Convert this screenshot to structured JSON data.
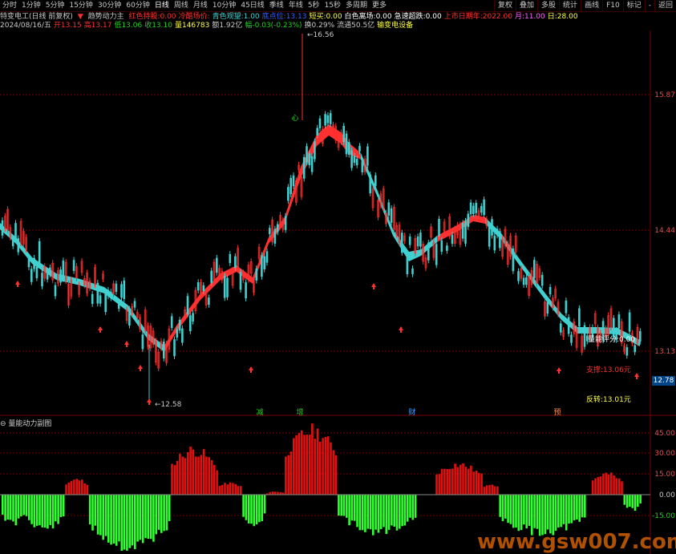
{
  "toolbar": {
    "periods": [
      "分时",
      "1分钟",
      "5分钟",
      "15分钟",
      "30分钟",
      "60分钟",
      "日线",
      "周线",
      "月线",
      "10分钟",
      "45日线",
      "季线",
      "年线",
      "5秒",
      "15秒",
      "多周期",
      "更多"
    ],
    "active_index": 6,
    "right_items": [
      "复权",
      "叠加",
      "多股",
      "统计",
      "画线",
      "F10",
      "标记",
      "-",
      "返回"
    ]
  },
  "legend_line1": {
    "stock": "特变电工(日线 前复权)",
    "indicator": "趋势动力主",
    "items": [
      {
        "label": "红色持股:",
        "value": "0.00",
        "color": "#ff3030"
      },
      {
        "label": "冷酷场价:",
        "value": "",
        "color": "#ff3030"
      },
      {
        "label": "青色观望:",
        "value": "1.00",
        "color": "#40d0d0"
      },
      {
        "label": "底点位:",
        "value": "13.13",
        "color": "#3060ff"
      },
      {
        "label": "短买:",
        "value": "0.00",
        "color": "#ffff40"
      },
      {
        "label": "白色离场:",
        "value": "0.00",
        "color": "#ffffff"
      },
      {
        "label": "急速超跌:",
        "value": "0.00",
        "color": "#ffffff"
      },
      {
        "label": "上市日期年:",
        "value": "2022.00",
        "color": "#ff3030"
      },
      {
        "label": "月:",
        "value": "11.00",
        "color": "#ff60ff"
      },
      {
        "label": "日:",
        "value": "28.00",
        "color": "#ffff40"
      }
    ]
  },
  "legend_line2": [
    {
      "text": "2024/08/16/五",
      "color": "#c8c8c8"
    },
    {
      "text": "开13.15",
      "color": "#ff3030"
    },
    {
      "text": "高13.17",
      "color": "#ff3030"
    },
    {
      "text": "低13.06",
      "color": "#20d020"
    },
    {
      "text": "收13.10",
      "color": "#20d020"
    },
    {
      "text": "量146783",
      "color": "#ffff40"
    },
    {
      "text": "额1.92亿",
      "color": "#c8c8c8"
    },
    {
      "text": "幅-0.03(-0.23%)",
      "color": "#20d020"
    },
    {
      "text": "换0.29%",
      "color": "#c8c8c8"
    },
    {
      "text": "流通50.5亿",
      "color": "#c8c8c8"
    },
    {
      "text": "输变电设备",
      "color": "#ffff40"
    }
  ],
  "price_axis": [
    "15.87",
    "14.44",
    "13.13"
  ],
  "price_tag": "12.78",
  "annotations": {
    "high": "16.56",
    "low": "12.58",
    "score": "量能评分:0.00",
    "support": "支撑:13.06元",
    "reverse": "反转:13.01元"
  },
  "event_markers": [
    "减",
    "增",
    "财",
    "预"
  ],
  "sub_title": "量能动力副图",
  "sub_axis": [
    "45.00",
    "30.00",
    "15.00",
    "0.00",
    "-15.00"
  ],
  "watermark": "www.gsw007.com",
  "colors": {
    "up": "#ff3030",
    "down": "#40d0d0",
    "bar_up": "#e01010",
    "bar_down": "#30ff30"
  }
}
